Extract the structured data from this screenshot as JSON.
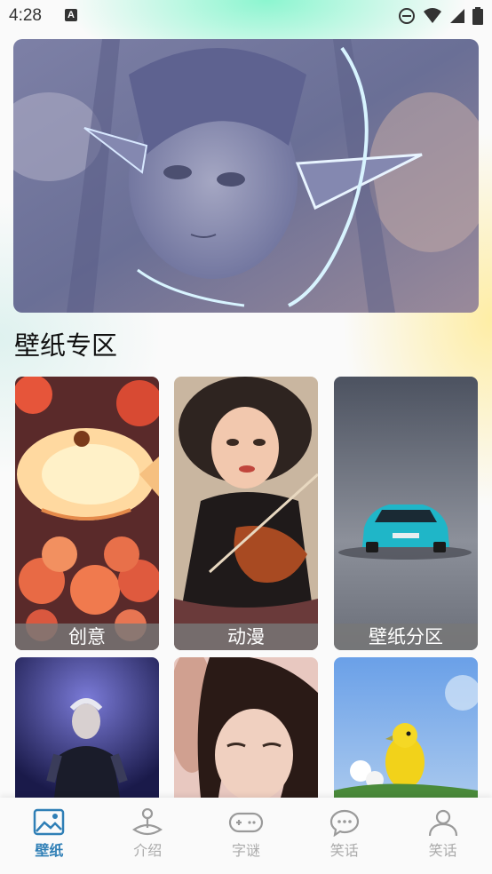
{
  "status_bar": {
    "time": "4:28",
    "app_icon_letter": "A",
    "icons": [
      "dnd-icon",
      "wifi-icon",
      "signal-icon",
      "battery-icon"
    ]
  },
  "hero": {
    "image": "anime-elf-girl-illustration"
  },
  "section": {
    "title": "壁纸专区"
  },
  "grid": [
    {
      "label": "创意",
      "image": "lantern-koi-fish"
    },
    {
      "label": "动漫",
      "image": "girl-violin"
    },
    {
      "label": "壁纸分区",
      "image": "teal-car"
    },
    {
      "label": "",
      "image": "performer-stage"
    },
    {
      "label": "",
      "image": "woman-portrait"
    },
    {
      "label": "",
      "image": "yellow-bird-flowers"
    }
  ],
  "bottom_nav": [
    {
      "label": "壁纸",
      "icon": "wallpaper-icon",
      "active": true
    },
    {
      "label": "介绍",
      "icon": "joystick-icon",
      "active": false
    },
    {
      "label": "字谜",
      "icon": "gamepad-icon",
      "active": false
    },
    {
      "label": "笑话",
      "icon": "chat-bubble-icon",
      "active": false
    },
    {
      "label": "笑话",
      "icon": "person-icon",
      "active": false
    }
  ],
  "colors": {
    "accent": "#2f7fb6",
    "inactive": "#aaaaaa",
    "caption_bg": "#787878"
  }
}
